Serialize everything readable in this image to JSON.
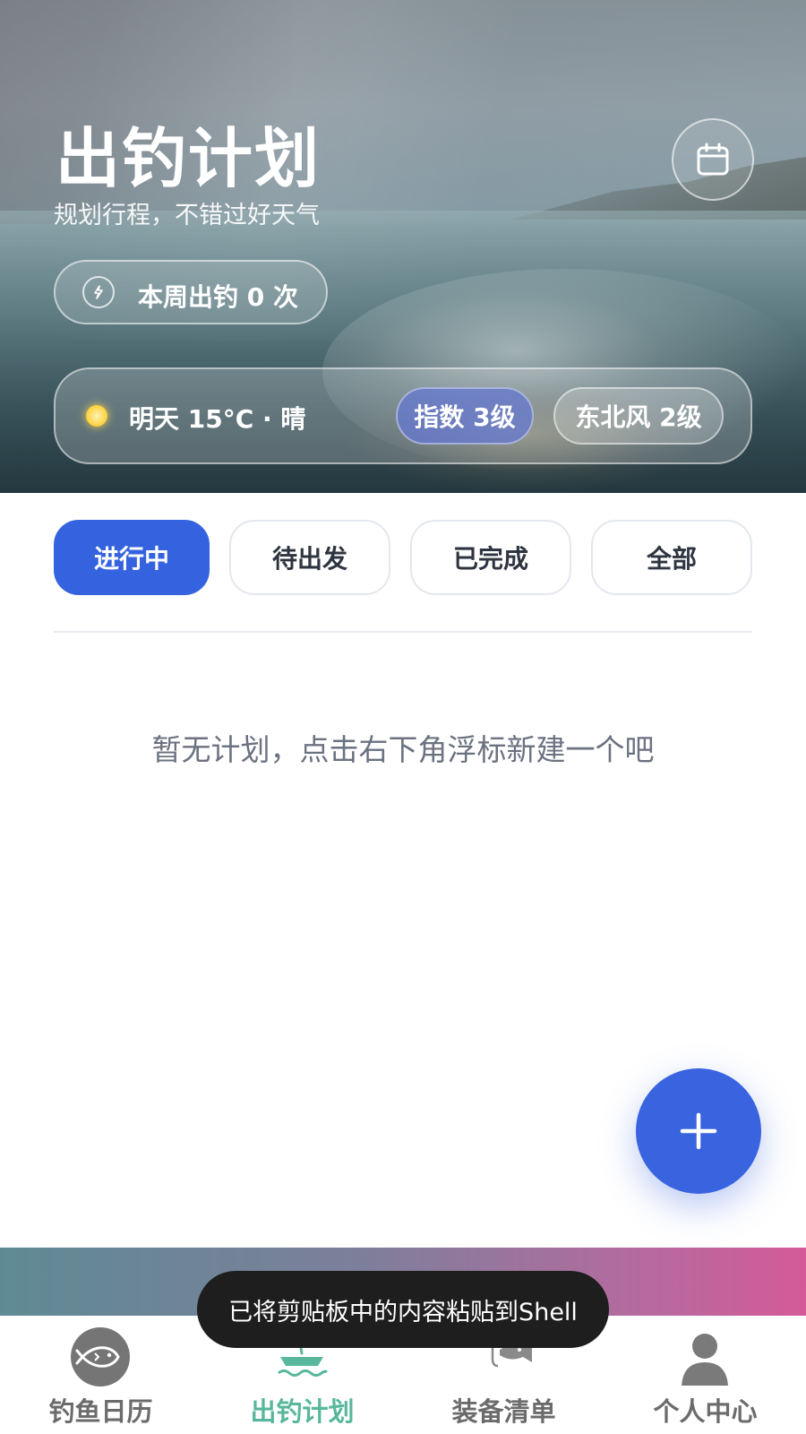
{
  "header": {
    "title": "出钓计划",
    "subtitle": "规划行程，不错过好天气",
    "calendar_icon": "calendar-icon",
    "week_count_text": "本周出钓 0 次",
    "week_count_icon": "lightning-icon"
  },
  "weather": {
    "icon": "sun-icon",
    "text": "明天 15°C · 晴",
    "index_badge": "指数 3级",
    "wind_badge": "东北风 2级"
  },
  "tabs": [
    {
      "label": "进行中",
      "active": true
    },
    {
      "label": "待出发",
      "active": false
    },
    {
      "label": "已完成",
      "active": false
    },
    {
      "label": "全部",
      "active": false
    }
  ],
  "empty_state": "暂无计划，点击右下角浮标新建一个吧",
  "fab": {
    "icon": "plus-icon"
  },
  "toast": "已将剪贴板中的内容粘贴到Shell",
  "nav": [
    {
      "label": "钓鱼日历",
      "icon": "fish-icon",
      "active": false
    },
    {
      "label": "出钓计划",
      "icon": "boat-icon",
      "active": true
    },
    {
      "label": "装备清单",
      "icon": "hook-fish-icon",
      "active": false
    },
    {
      "label": "个人中心",
      "icon": "person-icon",
      "active": false
    }
  ],
  "colors": {
    "accent": "#3563e0",
    "nav_active": "#58b79c",
    "nav_inactive": "#6b6b6b"
  }
}
